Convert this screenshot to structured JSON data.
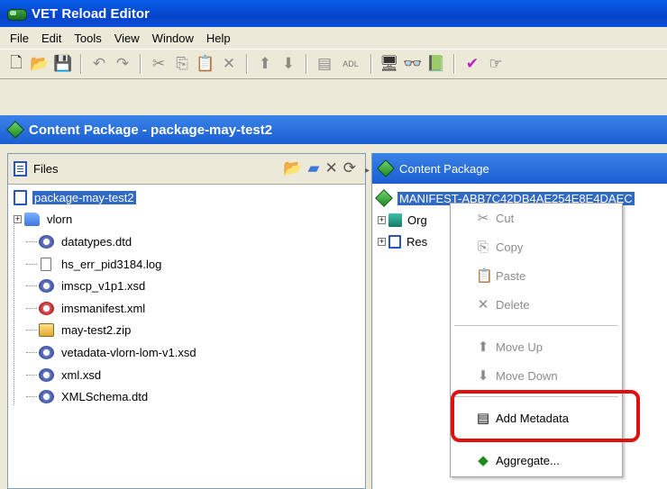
{
  "window": {
    "title": "VET Reload Editor"
  },
  "menubar": {
    "items": [
      "File",
      "Edit",
      "Tools",
      "View",
      "Window",
      "Help"
    ]
  },
  "toolbar": {
    "adl_label": "ADL"
  },
  "package_header": {
    "title": "Content Package - package-may-test2"
  },
  "files_panel": {
    "title": "Files",
    "root": "package-may-test2",
    "items": [
      {
        "name": "vlorn",
        "type": "folder"
      },
      {
        "name": "datatypes.dtd",
        "type": "xml"
      },
      {
        "name": "hs_err_pid3184.log",
        "type": "doc"
      },
      {
        "name": "imscp_v1p1.xsd",
        "type": "xml"
      },
      {
        "name": "imsmanifest.xml",
        "type": "xml-red"
      },
      {
        "name": "may-test2.zip",
        "type": "zip"
      },
      {
        "name": "vetadata-vlorn-lom-v1.xsd",
        "type": "xml"
      },
      {
        "name": "xml.xsd",
        "type": "xml"
      },
      {
        "name": "XMLSchema.dtd",
        "type": "xml"
      }
    ]
  },
  "content_panel": {
    "title": "Content Package",
    "manifest": "MANIFEST-ABB7C42DB4AE254E8E4DAEC",
    "children": [
      "Org",
      "Res"
    ]
  },
  "context_menu": {
    "items": [
      {
        "label": "Cut",
        "enabled": false
      },
      {
        "label": "Copy",
        "enabled": false
      },
      {
        "label": "Paste",
        "enabled": false
      },
      {
        "label": "Delete",
        "enabled": false
      },
      {
        "label": "Move Up",
        "enabled": false
      },
      {
        "label": "Move Down",
        "enabled": false
      },
      {
        "label": "Add Metadata",
        "enabled": true
      },
      {
        "label": "Aggregate...",
        "enabled": true
      }
    ]
  },
  "colors": {
    "highlight": "#e01010",
    "selection": "#316ac5",
    "titlebar": "#0543c9"
  }
}
